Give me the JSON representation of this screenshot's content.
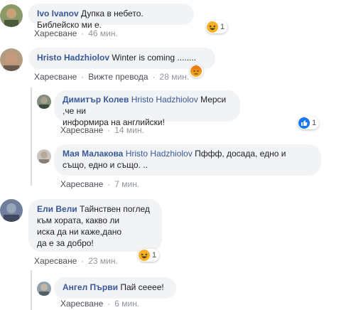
{
  "actions": {
    "like": "Харесване",
    "translate": "Вижте превода",
    "sep": "·"
  },
  "comments": [
    {
      "author": "Ivo Ivanov",
      "text": "Дупка в небето. Библейско ми е.",
      "time": "46 мин.",
      "reaction": {
        "type": "haha",
        "count": "1"
      }
    },
    {
      "author": "Hristo Hadzhiolov",
      "text": "Winter is coming ........",
      "time": "28 мин.",
      "reaction": {
        "type": "angry"
      }
    },
    {
      "author": "Димитър Колев",
      "mention": "Hristo Hadzhiolov",
      "text": "Мерси ,че ни информира на английски!",
      "line1": "Мерси ,че ни",
      "line2": "информира на английски!",
      "time": "14 мин.",
      "reaction": {
        "type": "like",
        "count": "1"
      }
    },
    {
      "author": "Мая Малакова",
      "mention": "Hristo Hadzhiolov",
      "text": "Пфф, досада, едно и също, едно и също. ..",
      "line1": "Пффф, досада, едно и",
      "line2": "също, едно и също. ..",
      "time": "7 мин."
    },
    {
      "author": "Ели Вели",
      "line1": "Тайнствен поглед",
      "line2": "към хората, какво ли",
      "line3": "иска да ни каже,дано",
      "line4": "да е за добро!",
      "time": "23 мин.",
      "reaction": {
        "type": "haha",
        "count": "1"
      }
    },
    {
      "author": "Ангел Първи",
      "text": "Пай сееее!",
      "time": "6 мин."
    }
  ],
  "colors": {
    "name": "#385898",
    "bubble": "#f2f3f5",
    "meta": "#90949c",
    "like_blue": "#1877f2",
    "haha_yellow": "#f7b125",
    "angry_orange": "#e9710f"
  }
}
